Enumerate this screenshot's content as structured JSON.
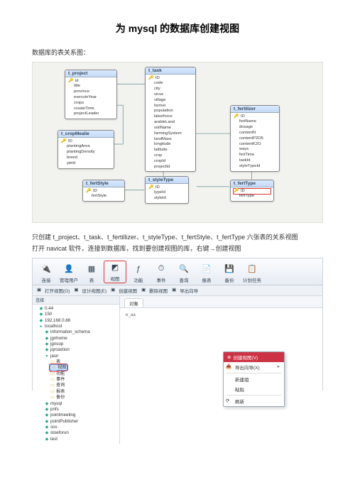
{
  "title": "为 mysql 的数据库创建视图",
  "intro": "数据库的表关系图：",
  "er": {
    "tables": {
      "t_project": {
        "name": "t_project",
        "cols": [
          "id",
          "title",
          "province",
          "executeYear",
          "crops",
          "createTime",
          "projectLeader"
        ]
      },
      "t_cropMealie": {
        "name": "t_cropMealie",
        "cols": [
          "ID",
          "plantingArea",
          "plantingDensity",
          "breed",
          "yield"
        ]
      },
      "t_fertStyle": {
        "name": "t_fertStyle",
        "cols": [
          "ID",
          "fertStyle"
        ]
      },
      "t_task": {
        "name": "t_task",
        "cols": [
          "ID",
          "code",
          "city",
          "vicus",
          "village",
          "farmer",
          "population",
          "laborforce",
          "arableLand",
          "soilName",
          "farmingSystem",
          "landMass",
          "longitude",
          "latitude",
          "crop",
          "cropId",
          "projectId"
        ]
      },
      "t_styleType": {
        "name": "t_styleType",
        "cols": [
          "ID",
          "typeId",
          "styleId"
        ]
      },
      "t_fertilizer": {
        "name": "t_fertilizer",
        "cols": [
          "ID",
          "fertName",
          "dosage",
          "contentN",
          "contentP2O5",
          "contentK2O",
          "ways",
          "fertTime",
          "taskId",
          "styleTypeId"
        ]
      },
      "t_fertType": {
        "name": "t_fertType",
        "cols": [
          "ID",
          "fertType"
        ],
        "highlightIndex": 0
      }
    }
  },
  "middle_para": "只创建 t_project、t_task、t_fertillizer、t_styleType、t_fertStyle、t_fertType 六张表的关系视图",
  "open_para": "打开 navicat 软件，连接到数据库，找到要创建视图的库，右键→创建视图",
  "toolbar": {
    "items": [
      {
        "label": "连接",
        "icon": "🔌",
        "name": "connect-button"
      },
      {
        "label": "管理用户",
        "icon": "👤",
        "name": "manage-user-button"
      },
      {
        "label": "表",
        "icon": "▦",
        "name": "table-button"
      },
      {
        "label": "视图",
        "icon": "◩",
        "name": "view-button",
        "highlight": true
      },
      {
        "label": "功能",
        "icon": "ƒ",
        "name": "function-button"
      },
      {
        "label": "事件",
        "icon": "⏱",
        "name": "event-button"
      },
      {
        "label": "查询",
        "icon": "🔍",
        "name": "query-button"
      },
      {
        "label": "报表",
        "icon": "📄",
        "name": "report-button"
      },
      {
        "label": "备份",
        "icon": "💾",
        "name": "backup-button"
      },
      {
        "label": "计划任务",
        "icon": "📋",
        "name": "schedule-button"
      }
    ]
  },
  "subbar": {
    "items": [
      {
        "label": "打开视图(O)",
        "name": "open-view"
      },
      {
        "label": "设计视图(E)",
        "name": "design-view"
      },
      {
        "label": "创建视图",
        "name": "create-view"
      },
      {
        "label": "删除视图",
        "name": "delete-view"
      },
      {
        "label": "导出向导",
        "name": "export-wizard"
      }
    ]
  },
  "tree": {
    "pane_label": "连接",
    "top": [
      {
        "label": "0.44",
        "name": "conn-0-44"
      },
      {
        "label": "150",
        "name": "conn-150"
      },
      {
        "label": "192.168.0.88",
        "name": "conn-192-168-0-88"
      },
      {
        "label": "localhost",
        "name": "conn-localhost"
      }
    ],
    "localhost_dbs": [
      "information_schema",
      "jgnhome",
      "jgnsop",
      "jqroaxtion"
    ],
    "jasn_children": [
      {
        "label": "表",
        "name": "tables-folder"
      },
      {
        "label": "视图",
        "name": "views-folder",
        "sel": true,
        "hl": true
      },
      {
        "label": "功能",
        "name": "functions-folder"
      },
      {
        "label": "事件",
        "name": "events-folder"
      },
      {
        "label": "查询",
        "name": "queries-folder"
      },
      {
        "label": "报表",
        "name": "reports-folder"
      },
      {
        "label": "备份",
        "name": "backups-folder"
      }
    ],
    "after_dbs": [
      "mysql",
      "pnfs",
      "pointmeeting",
      "pointPublisher",
      "sos",
      "stoeforun",
      "test"
    ],
    "open_db": "jasn"
  },
  "main_tabs": {
    "objects": "对象"
  },
  "obj_list_placeholder": "e_aa",
  "ctx": {
    "title": "创建视图(V)",
    "items": [
      {
        "label": "导出向导(X)",
        "name": "ctx-export-wizard"
      },
      {
        "label": "新建组",
        "name": "ctx-new-group"
      },
      {
        "label": "粘贴",
        "name": "ctx-paste"
      },
      {
        "label": "刷新",
        "name": "ctx-refresh"
      }
    ]
  }
}
